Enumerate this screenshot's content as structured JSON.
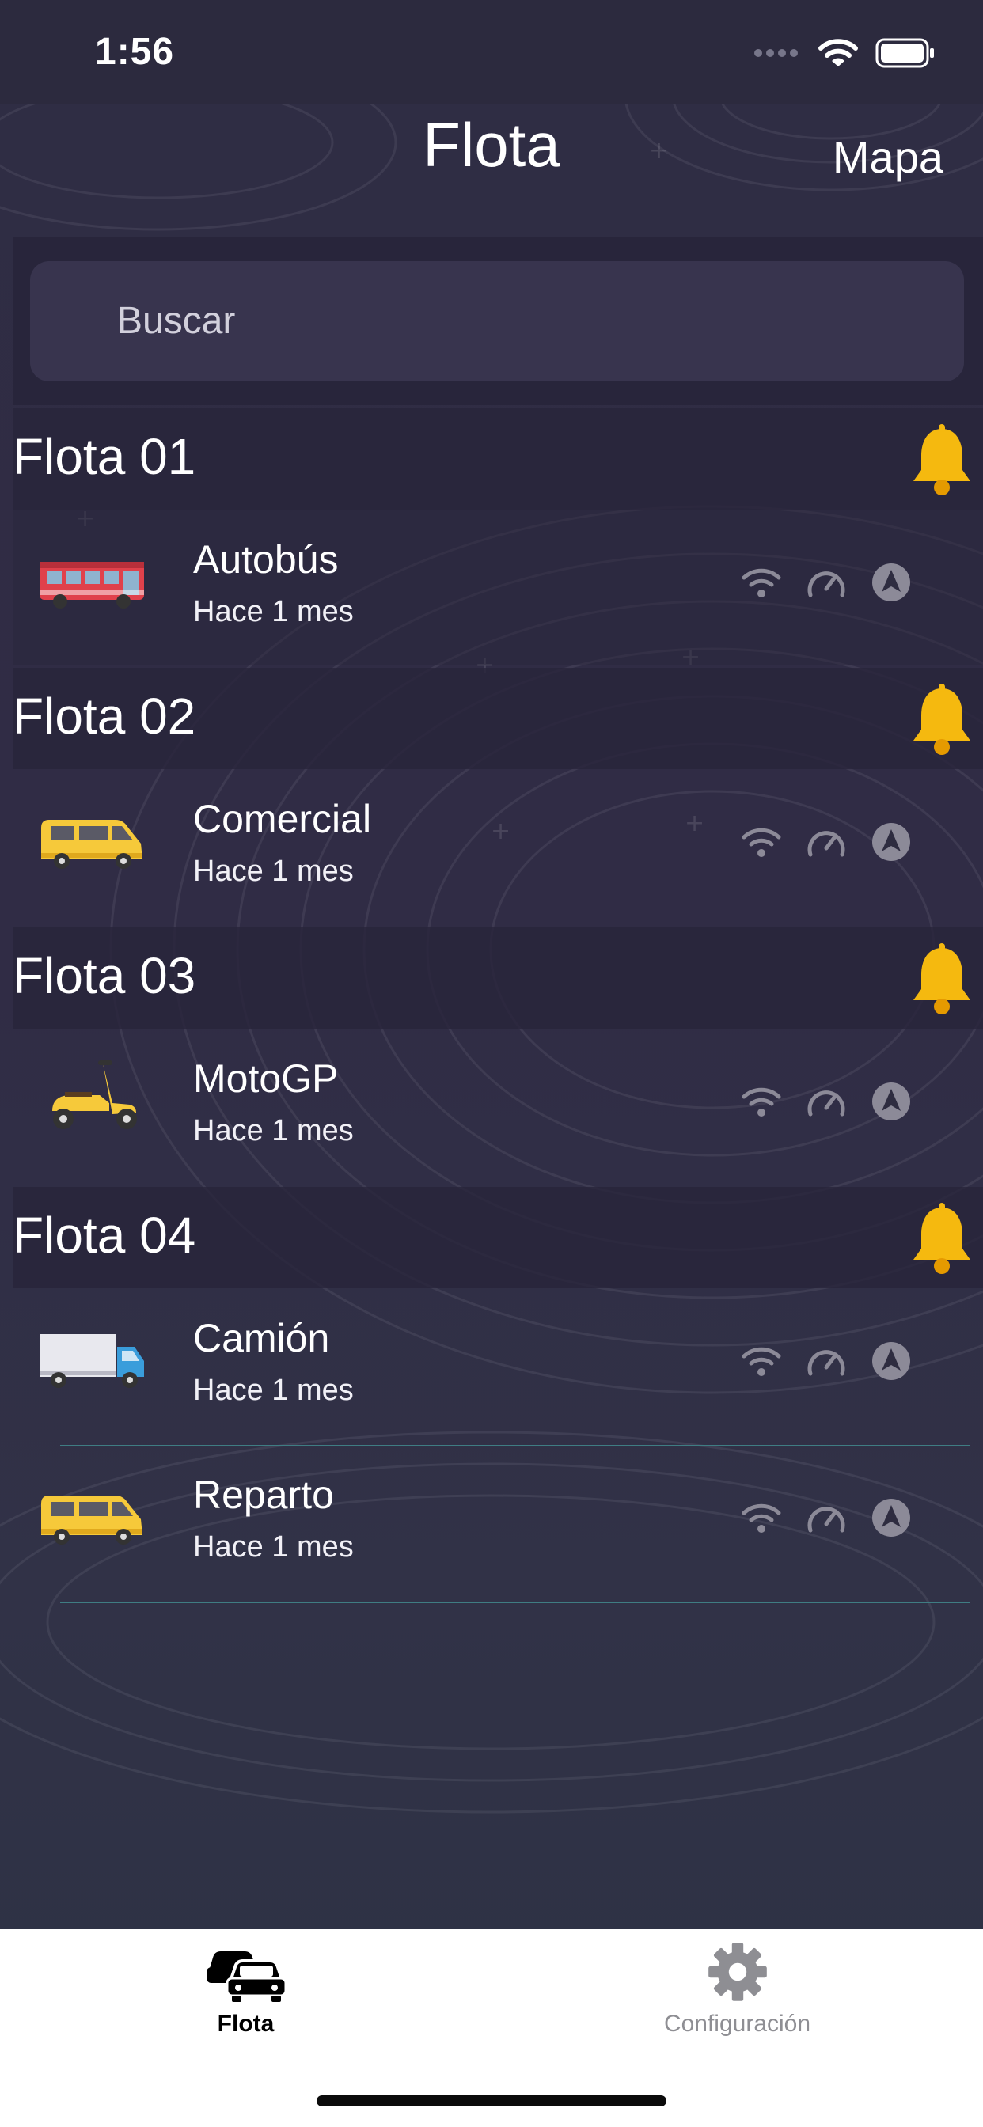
{
  "status": {
    "time": "1:56"
  },
  "nav": {
    "title": "Flota",
    "right_button": "Mapa"
  },
  "search": {
    "placeholder": "Buscar"
  },
  "colors": {
    "bell": "#f5b90f",
    "tab_active": "#000000",
    "tab_inactive": "#8e8e93",
    "separator": "#3f7d83"
  },
  "sections": [
    {
      "title": "Flota 01",
      "vehicles": [
        {
          "name": "Autobús",
          "subtitle": "Hace 1 mes",
          "icon": "bus-icon"
        }
      ]
    },
    {
      "title": "Flota 02",
      "vehicles": [
        {
          "name": "Comercial",
          "subtitle": "Hace 1 mes",
          "icon": "van-icon"
        }
      ]
    },
    {
      "title": "Flota 03",
      "vehicles": [
        {
          "name": "MotoGP",
          "subtitle": "Hace 1 mes",
          "icon": "scooter-icon"
        }
      ]
    },
    {
      "title": "Flota 04",
      "vehicles": [
        {
          "name": "Camión",
          "subtitle": "Hace 1 mes",
          "icon": "truck-icon"
        },
        {
          "name": "Reparto",
          "subtitle": "Hace 1 mes",
          "icon": "van-icon"
        }
      ]
    }
  ],
  "tabs": [
    {
      "label": "Flota",
      "icon": "cars-icon",
      "active": true
    },
    {
      "label": "Configuración",
      "icon": "gear-icon",
      "active": false
    }
  ]
}
